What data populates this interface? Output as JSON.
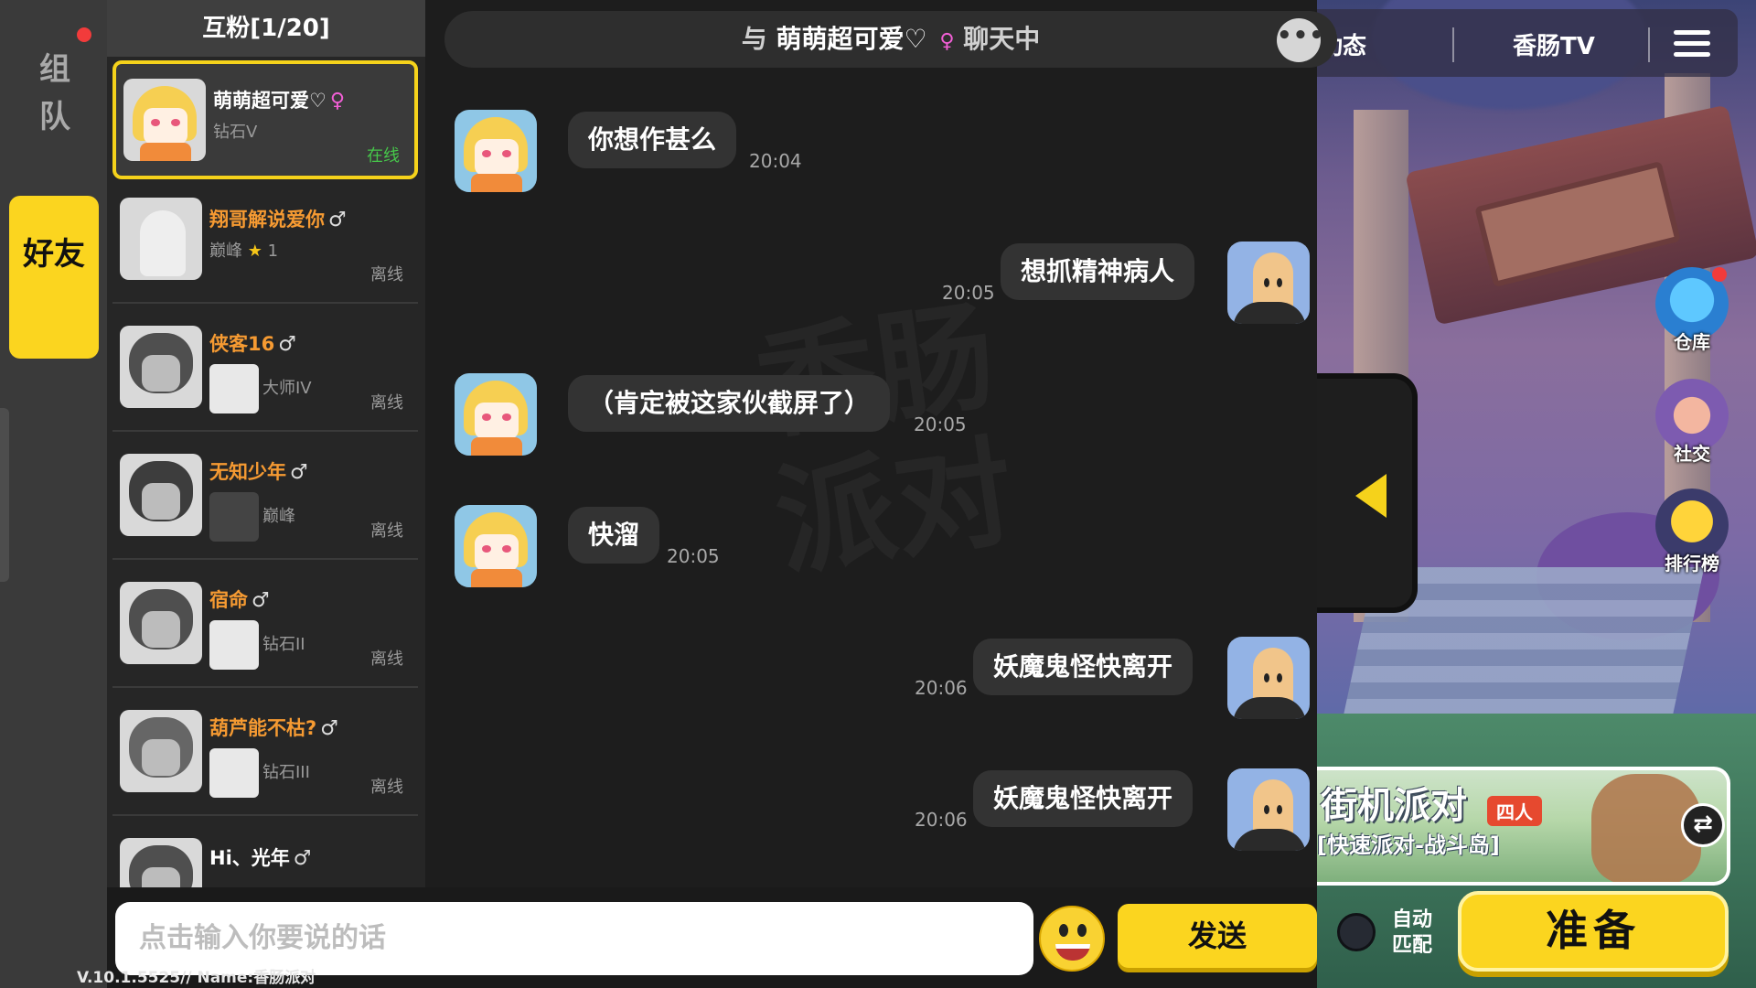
{
  "left_nav": {
    "team_label": "组队",
    "friends_label": "好友"
  },
  "friend_list": {
    "header": "互粉[1/20]",
    "friends": [
      {
        "name": "萌萌超可爱♡",
        "gender_symbol": "♀",
        "rank": "钻石V",
        "status": "在线"
      },
      {
        "name": "翔哥解说爱你",
        "gender_symbol": "♂",
        "rank": "巅峰",
        "stars": "1",
        "status": "离线"
      },
      {
        "name": "侠客16",
        "gender_symbol": "♂",
        "rank": "大师IV",
        "status": "离线"
      },
      {
        "name": "无知少年",
        "gender_symbol": "♂",
        "rank": "巅峰",
        "status": "离线"
      },
      {
        "name": "宿命",
        "gender_symbol": "♂",
        "rank": "钻石II",
        "status": "离线"
      },
      {
        "name": "葫芦能不枯?",
        "gender_symbol": "♂",
        "rank": "钻石III",
        "status": "离线"
      },
      {
        "name": "Hi、光年",
        "gender_symbol": "♂"
      }
    ]
  },
  "chat": {
    "header_prefix": "与",
    "header_name": "萌萌超可爱♡",
    "header_gender": "♀",
    "header_suffix": "聊天中",
    "messages": [
      {
        "side": "left",
        "text": "你想作甚么",
        "time": "20:04"
      },
      {
        "side": "right",
        "text": "想抓精神病人",
        "time": "20:05"
      },
      {
        "side": "left",
        "text": "（肯定被这家伙截屏了）",
        "time": "20:05"
      },
      {
        "side": "left",
        "text": "快溜",
        "time": "20:05"
      },
      {
        "side": "right",
        "text": "妖魔鬼怪快离开",
        "time": "20:06"
      },
      {
        "side": "right",
        "text": "妖魔鬼怪快离开",
        "time": "20:06"
      }
    ],
    "input_placeholder": "点击输入你要说的话",
    "send_label": "发送"
  },
  "game": {
    "top_tabs": [
      "动态",
      "香肠TV"
    ],
    "side_buttons": [
      "仓库",
      "社交",
      "排行榜"
    ],
    "mode_title": "街机派对",
    "mode_badge": "四人",
    "mode_sub": "[快速派对-战斗岛]",
    "auto_match": "自动匹配",
    "ready_label": "准备"
  },
  "version_text": "V.10.1.5525// Name:香肠派对"
}
